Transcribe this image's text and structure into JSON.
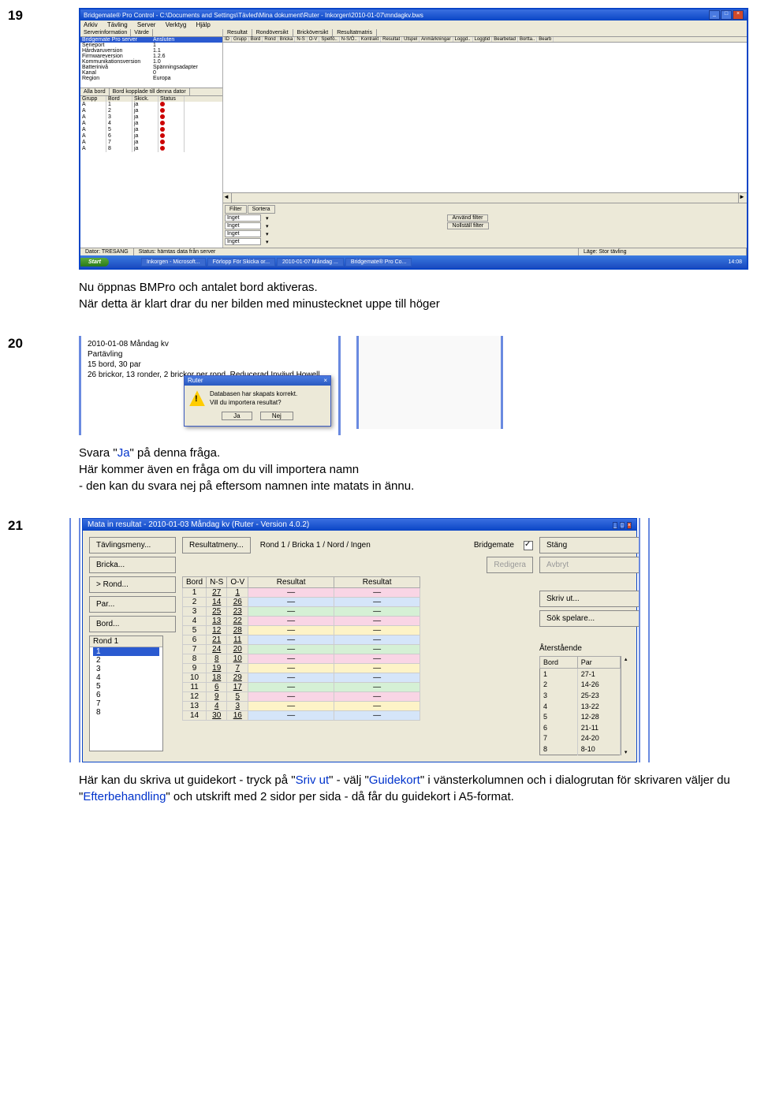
{
  "steps": {
    "s19": "19",
    "s20": "20",
    "s21": "21"
  },
  "cap19a": "Nu öppnas BMPro och antalet bord aktiveras.",
  "cap19b": "När detta är klart drar du ner bilden med minustecknet uppe till höger",
  "cap20a": "Svara \"",
  "cap20ja": "Ja",
  "cap20b": "\" på denna fråga.",
  "cap20c": "Här kommer även en fråga om du vill importera namn",
  "cap20d": " - den kan du svara nej på eftersom namnen inte matats in ännu.",
  "cap21a": "Här kan du skriva ut guidekort - tryck på \"",
  "cap21b": "Sriv ut",
  "cap21c": "\" - välj \"",
  "cap21d": "Guidekort",
  "cap21e": "\" i vänsterkolumnen och i dialogrutan för skrivaren väljer du \"",
  "cap21f": "Efterbehandling",
  "cap21g": "\" och utskrift med 2 sidor per sida - då får du guidekort i A5-format.",
  "win19": {
    "title": "Bridgemate® Pro Control - C:\\Documents and Settings\\Tävled\\Mina dokument\\Ruter - Inkorgen\\2010-01-07\\mndagkv.bws",
    "menu": [
      "Arkiv",
      "Tävling",
      "Server",
      "Verktyg",
      "Hjälp"
    ],
    "srvhdr": [
      "Serverinformation",
      "Värde"
    ],
    "srv": [
      [
        "Bridgemate Pro server",
        "Ansluten"
      ],
      [
        "Serieport",
        "1"
      ],
      [
        "Hårdvaruversion",
        "1.1"
      ],
      [
        "Firmwareversion",
        "1.2.6"
      ],
      [
        "Kommunikationsversion",
        "1.0"
      ],
      [
        "Batterinivå",
        "Spänningsadapter"
      ],
      [
        "Kanal",
        "0"
      ],
      [
        "Region",
        "Europa"
      ]
    ],
    "bordtabs": [
      "Alla bord",
      "Bord kopplade till denna dator"
    ],
    "bordhdr": [
      "Grupp",
      "Bord",
      "Skick.",
      "Status"
    ],
    "bord": [
      [
        "A",
        "1",
        "ja"
      ],
      [
        "A",
        "2",
        "ja"
      ],
      [
        "A",
        "3",
        "ja"
      ],
      [
        "A",
        "4",
        "ja"
      ],
      [
        "A",
        "5",
        "ja"
      ],
      [
        "A",
        "6",
        "ja"
      ],
      [
        "A",
        "7",
        "ja"
      ],
      [
        "A",
        "8",
        "ja"
      ]
    ],
    "restabs": [
      "Resultat",
      "Rondöversikt",
      "Bricköversikt",
      "Resultatmatris"
    ],
    "reshdr": [
      "ID",
      "Grupp",
      "Bord",
      "Rond",
      "Bricka",
      "N-S",
      "O-V",
      "Spelfö..",
      "N-S/Ö..",
      "Kontrakt",
      "Resultat",
      "Utspel",
      "Anmärkningar",
      "Loggd..",
      "Loggtid",
      "Bearbetad",
      "Bortta..",
      "Bearb"
    ],
    "ftabs": [
      "Filter",
      "Sortera"
    ],
    "fsel": "Inget",
    "fbtn1": "Använd filter",
    "fbtn2": "Nollställ filter",
    "status": [
      "Dator: TRESANG",
      "Status: hämtas data från server",
      "Läge: Stor tävling"
    ],
    "start": "Start",
    "tasks": [
      "Inkorgen - Microsoft...",
      "Förlopp För Skicka or...",
      "2010-01-07  Måndag ...",
      "Bridgemate® Pro Co..."
    ],
    "clock": "14:08"
  },
  "p20": {
    "l1": "2010-01-08  Måndag kv",
    "l2": "Partävling",
    "l3": "15 bord, 30 par",
    "l4": "26 brickor, 13 ronder, 2 brickor per rond, Reducerad Invävd Howell",
    "dlgtitle": "Ruter",
    "msg1": "Databasen har skapats korrekt.",
    "msg2": "Vill du importera resultat?",
    "ja": "Ja",
    "nej": "Nej"
  },
  "p21": {
    "title": "Mata in resultat - 2010-01-03  Måndag kv  (Ruter - Version 4.0.2)",
    "btns": {
      "tav": "Tävlingsmeny...",
      "res": "Resultatmeny...",
      "bricka": "Bricka...",
      "rond": ">   Rond...",
      "par": "Par...",
      "bord": "Bord..."
    },
    "mid": "Rond 1 / Bricka 1 / Nord / Ingen",
    "bm": "Bridgemate",
    "redigera": "Redigera",
    "stang": "Stäng",
    "avbryt": "Avbryt",
    "skriv": "Skriv ut...",
    "sok": "Sök spelare...",
    "rondhdr": "Rond 1",
    "ronds": [
      "1",
      "2",
      "3",
      "4",
      "5",
      "6",
      "7",
      "8"
    ],
    "th": [
      "Bord",
      "N-S",
      "O-V",
      "Resultat",
      "Resultat"
    ],
    "rows": [
      {
        "c": "pk",
        "d": [
          "1",
          "27",
          "1",
          "—",
          "—"
        ]
      },
      {
        "c": "bl",
        "d": [
          "2",
          "14",
          "26",
          "—",
          "—"
        ]
      },
      {
        "c": "gr",
        "d": [
          "3",
          "25",
          "23",
          "—",
          "—"
        ]
      },
      {
        "c": "pk",
        "d": [
          "4",
          "13",
          "22",
          "—",
          "—"
        ]
      },
      {
        "c": "yl",
        "d": [
          "5",
          "12",
          "28",
          "—",
          "—"
        ]
      },
      {
        "c": "bl",
        "d": [
          "6",
          "21",
          "11",
          "—",
          "—"
        ]
      },
      {
        "c": "gr",
        "d": [
          "7",
          "24",
          "20",
          "—",
          "—"
        ]
      },
      {
        "c": "pk",
        "d": [
          "8",
          "8",
          "10",
          "—",
          "—"
        ]
      },
      {
        "c": "yl",
        "d": [
          "9",
          "19",
          "7",
          "—",
          "—"
        ]
      },
      {
        "c": "bl",
        "d": [
          "10",
          "18",
          "29",
          "—",
          "—"
        ]
      },
      {
        "c": "gr",
        "d": [
          "11",
          "6",
          "17",
          "—",
          "—"
        ]
      },
      {
        "c": "pk",
        "d": [
          "12",
          "9",
          "5",
          "—",
          "—"
        ]
      },
      {
        "c": "yl",
        "d": [
          "13",
          "4",
          "3",
          "—",
          "—"
        ]
      },
      {
        "c": "bl",
        "d": [
          "14",
          "30",
          "16",
          "—",
          "—"
        ]
      }
    ],
    "atlbl": "Återstående",
    "ath": [
      "Bord",
      "Par"
    ],
    "atrows": [
      [
        "1",
        "27-1"
      ],
      [
        "2",
        "14-26"
      ],
      [
        "3",
        "25-23"
      ],
      [
        "4",
        "13-22"
      ],
      [
        "5",
        "12-28"
      ],
      [
        "6",
        "21-11"
      ],
      [
        "7",
        "24-20"
      ],
      [
        "8",
        "8-10"
      ]
    ]
  }
}
